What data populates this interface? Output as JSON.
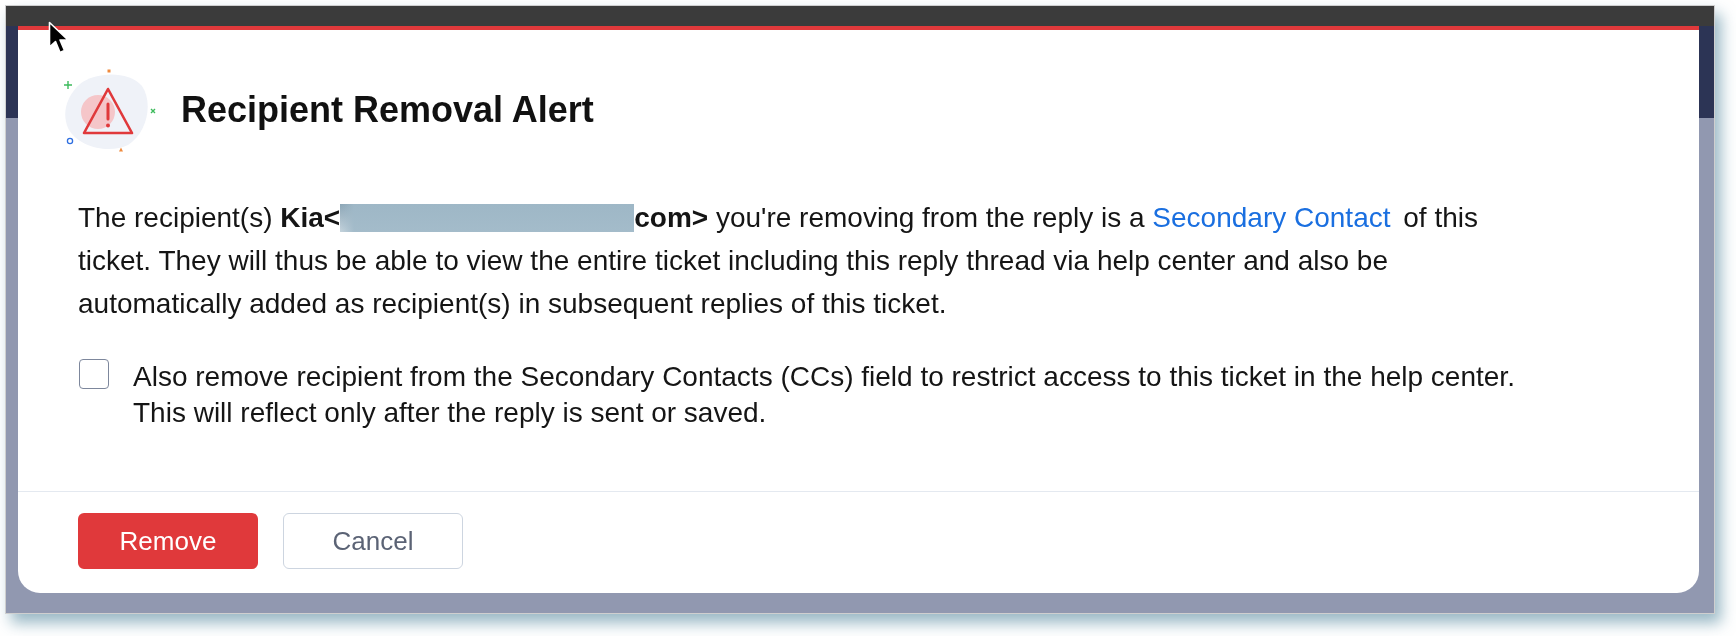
{
  "dialog": {
    "title": "Recipient Removal Alert",
    "message": [
      {
        "kind": "text",
        "text": "The recipient(s) **Kia<**"
      },
      {
        "kind": "redaction"
      },
      {
        "kind": "text",
        "text": "**com>** you're removing from the reply is a "
      },
      {
        "kind": "link",
        "text": "Secondary Contact"
      },
      {
        "kind": "text",
        "text": " of this ticket. They will thus be able to view the entire ticket including this reply thread via help center and also be automatically added as recipient(s) in subsequent replies of this ticket."
      }
    ],
    "option": {
      "checked": false,
      "label": "Also remove recipient from the Secondary Contacts (CCs) field to restrict access to this ticket in the help center.",
      "note": "This will reflect only after the reply is sent or saved."
    },
    "buttons": [
      {
        "kind": "primary",
        "label": "Remove"
      },
      {
        "kind": "secondary",
        "label": "Cancel"
      }
    ]
  }
}
